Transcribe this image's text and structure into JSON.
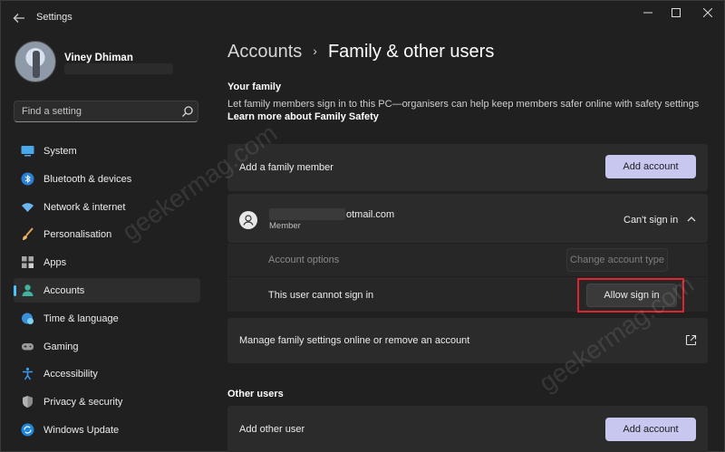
{
  "window": {
    "title": "Settings"
  },
  "profile": {
    "name": "Viney Dhiman"
  },
  "search": {
    "placeholder": "Find a setting"
  },
  "sidebar": {
    "items": [
      {
        "label": "System",
        "icon": "monitor-icon",
        "active": false
      },
      {
        "label": "Bluetooth & devices",
        "icon": "bluetooth-icon",
        "active": false
      },
      {
        "label": "Network & internet",
        "icon": "wifi-icon",
        "active": false
      },
      {
        "label": "Personalisation",
        "icon": "brush-icon",
        "active": false
      },
      {
        "label": "Apps",
        "icon": "apps-icon",
        "active": false
      },
      {
        "label": "Accounts",
        "icon": "person-icon",
        "active": true
      },
      {
        "label": "Time & language",
        "icon": "globe-clock-icon",
        "active": false
      },
      {
        "label": "Gaming",
        "icon": "gamepad-icon",
        "active": false
      },
      {
        "label": "Accessibility",
        "icon": "accessibility-icon",
        "active": false
      },
      {
        "label": "Privacy & security",
        "icon": "shield-icon",
        "active": false
      },
      {
        "label": "Windows Update",
        "icon": "update-icon",
        "active": false
      }
    ]
  },
  "header": {
    "parent": "Accounts",
    "separator": "›",
    "current": "Family & other users"
  },
  "family": {
    "heading": "Your family",
    "description": "Let family members sign in to this PC—organisers can help keep members safer online with safety settings",
    "learn_more": "Learn more about Family Safety",
    "add_label": "Add a family member",
    "add_button": "Add account",
    "member": {
      "email_suffix": "otmail.com",
      "role": "Member",
      "status": "Can't sign in"
    },
    "account_options_label": "Account options",
    "change_type_button": "Change account type",
    "cannot_sign_in_label": "This user cannot sign in",
    "allow_button": "Allow sign in",
    "manage_label": "Manage family settings online or remove an account"
  },
  "other_users": {
    "heading": "Other users",
    "add_label": "Add other user",
    "add_button": "Add account"
  },
  "watermark": "geekermag.com",
  "colors": {
    "accent": "#4cc2ff",
    "button_accent": "#c7c7f0",
    "highlight": "#e0242b",
    "background": "#202020",
    "card": "#2b2b2b"
  }
}
